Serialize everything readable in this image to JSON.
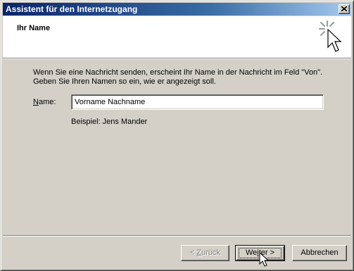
{
  "window": {
    "title": "Assistent für den Internetzugang"
  },
  "header": {
    "title": "Ihr Name"
  },
  "content": {
    "intro_line1": "Wenn Sie eine Nachricht senden, erscheint Ihr Name in der Nachricht im Feld \"Von\".",
    "intro_line2": "Geben Sie Ihren Namen so ein, wie er angezeigt soll.",
    "name_label_first": "N",
    "name_label_rest": "ame:",
    "name_value": "Vorname Nachname",
    "example": "Beispiel: Jens Mander"
  },
  "buttons": {
    "back_pre": "< ",
    "back_accel": "Z",
    "back_post": "urück",
    "next_pre": "We",
    "next_accel": "i",
    "next_post": "ter >",
    "cancel": "Abbrechen"
  },
  "colors": {
    "titlebar_start": "#0a246a",
    "titlebar_end": "#a6caf0",
    "face": "#d4d0c8"
  },
  "icons": {
    "close": "close-icon",
    "wizard": "wizard-cursor-sparkle-icon",
    "pointer": "mouse-pointer-icon"
  }
}
